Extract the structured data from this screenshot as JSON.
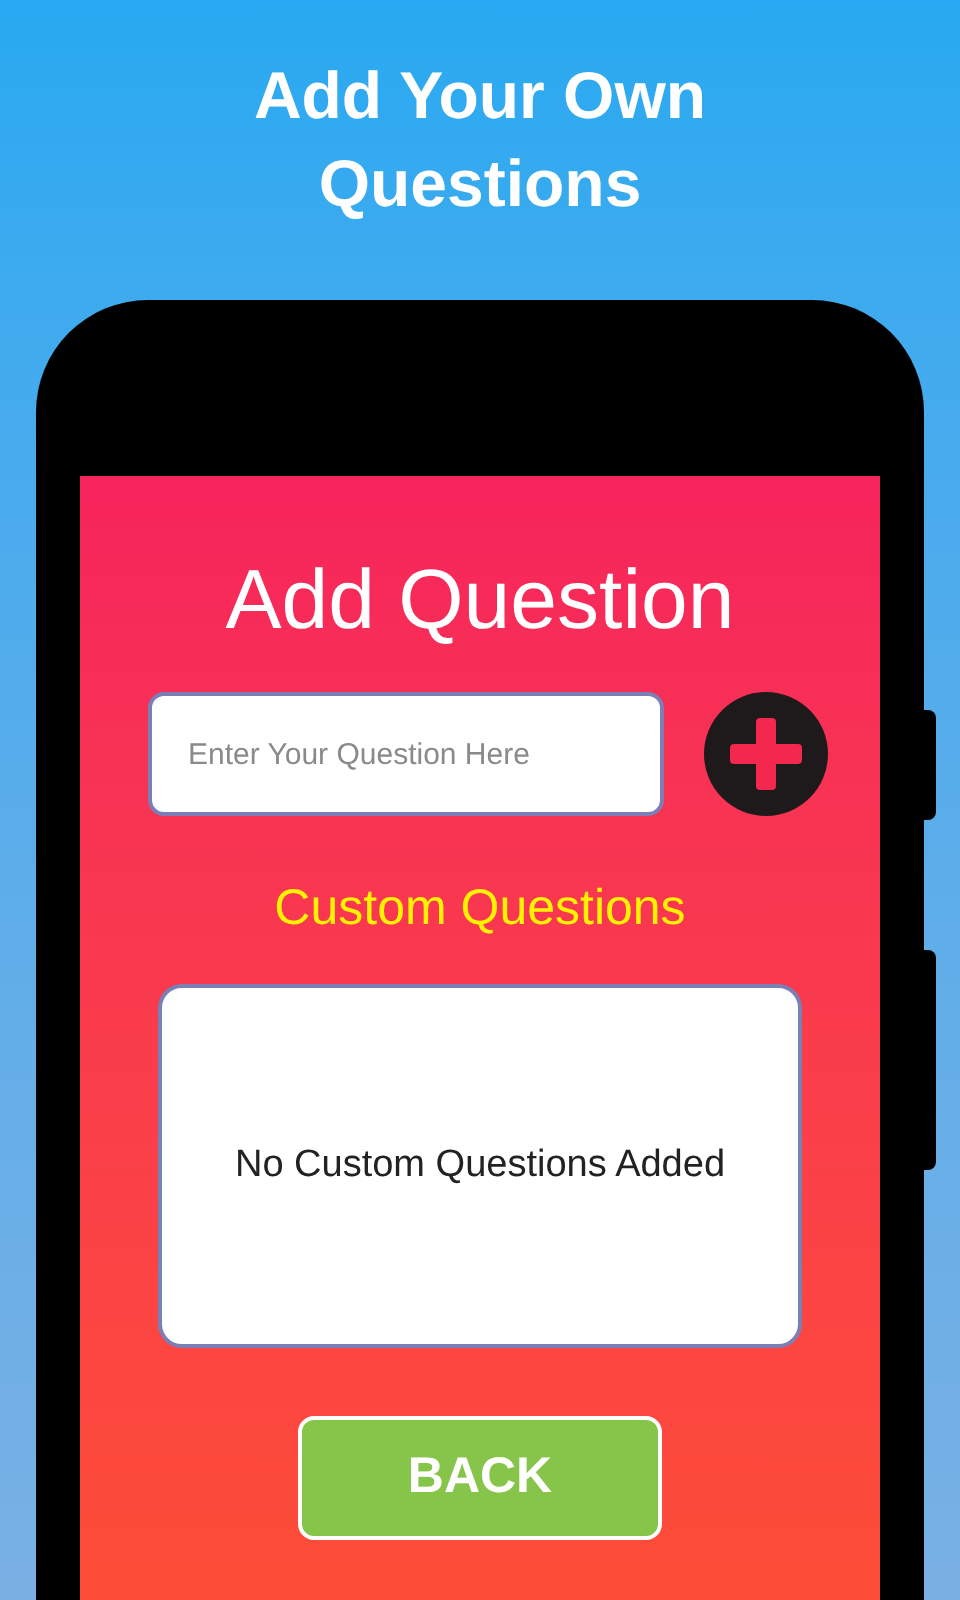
{
  "headline": "Add Your Own Questions",
  "screen": {
    "title": "Add Question",
    "question_field": {
      "placeholder": "Enter Your Question Here"
    },
    "section_title": "Custom Questions",
    "empty_message": "No Custom Questions Added",
    "back_button": "BACK"
  }
}
